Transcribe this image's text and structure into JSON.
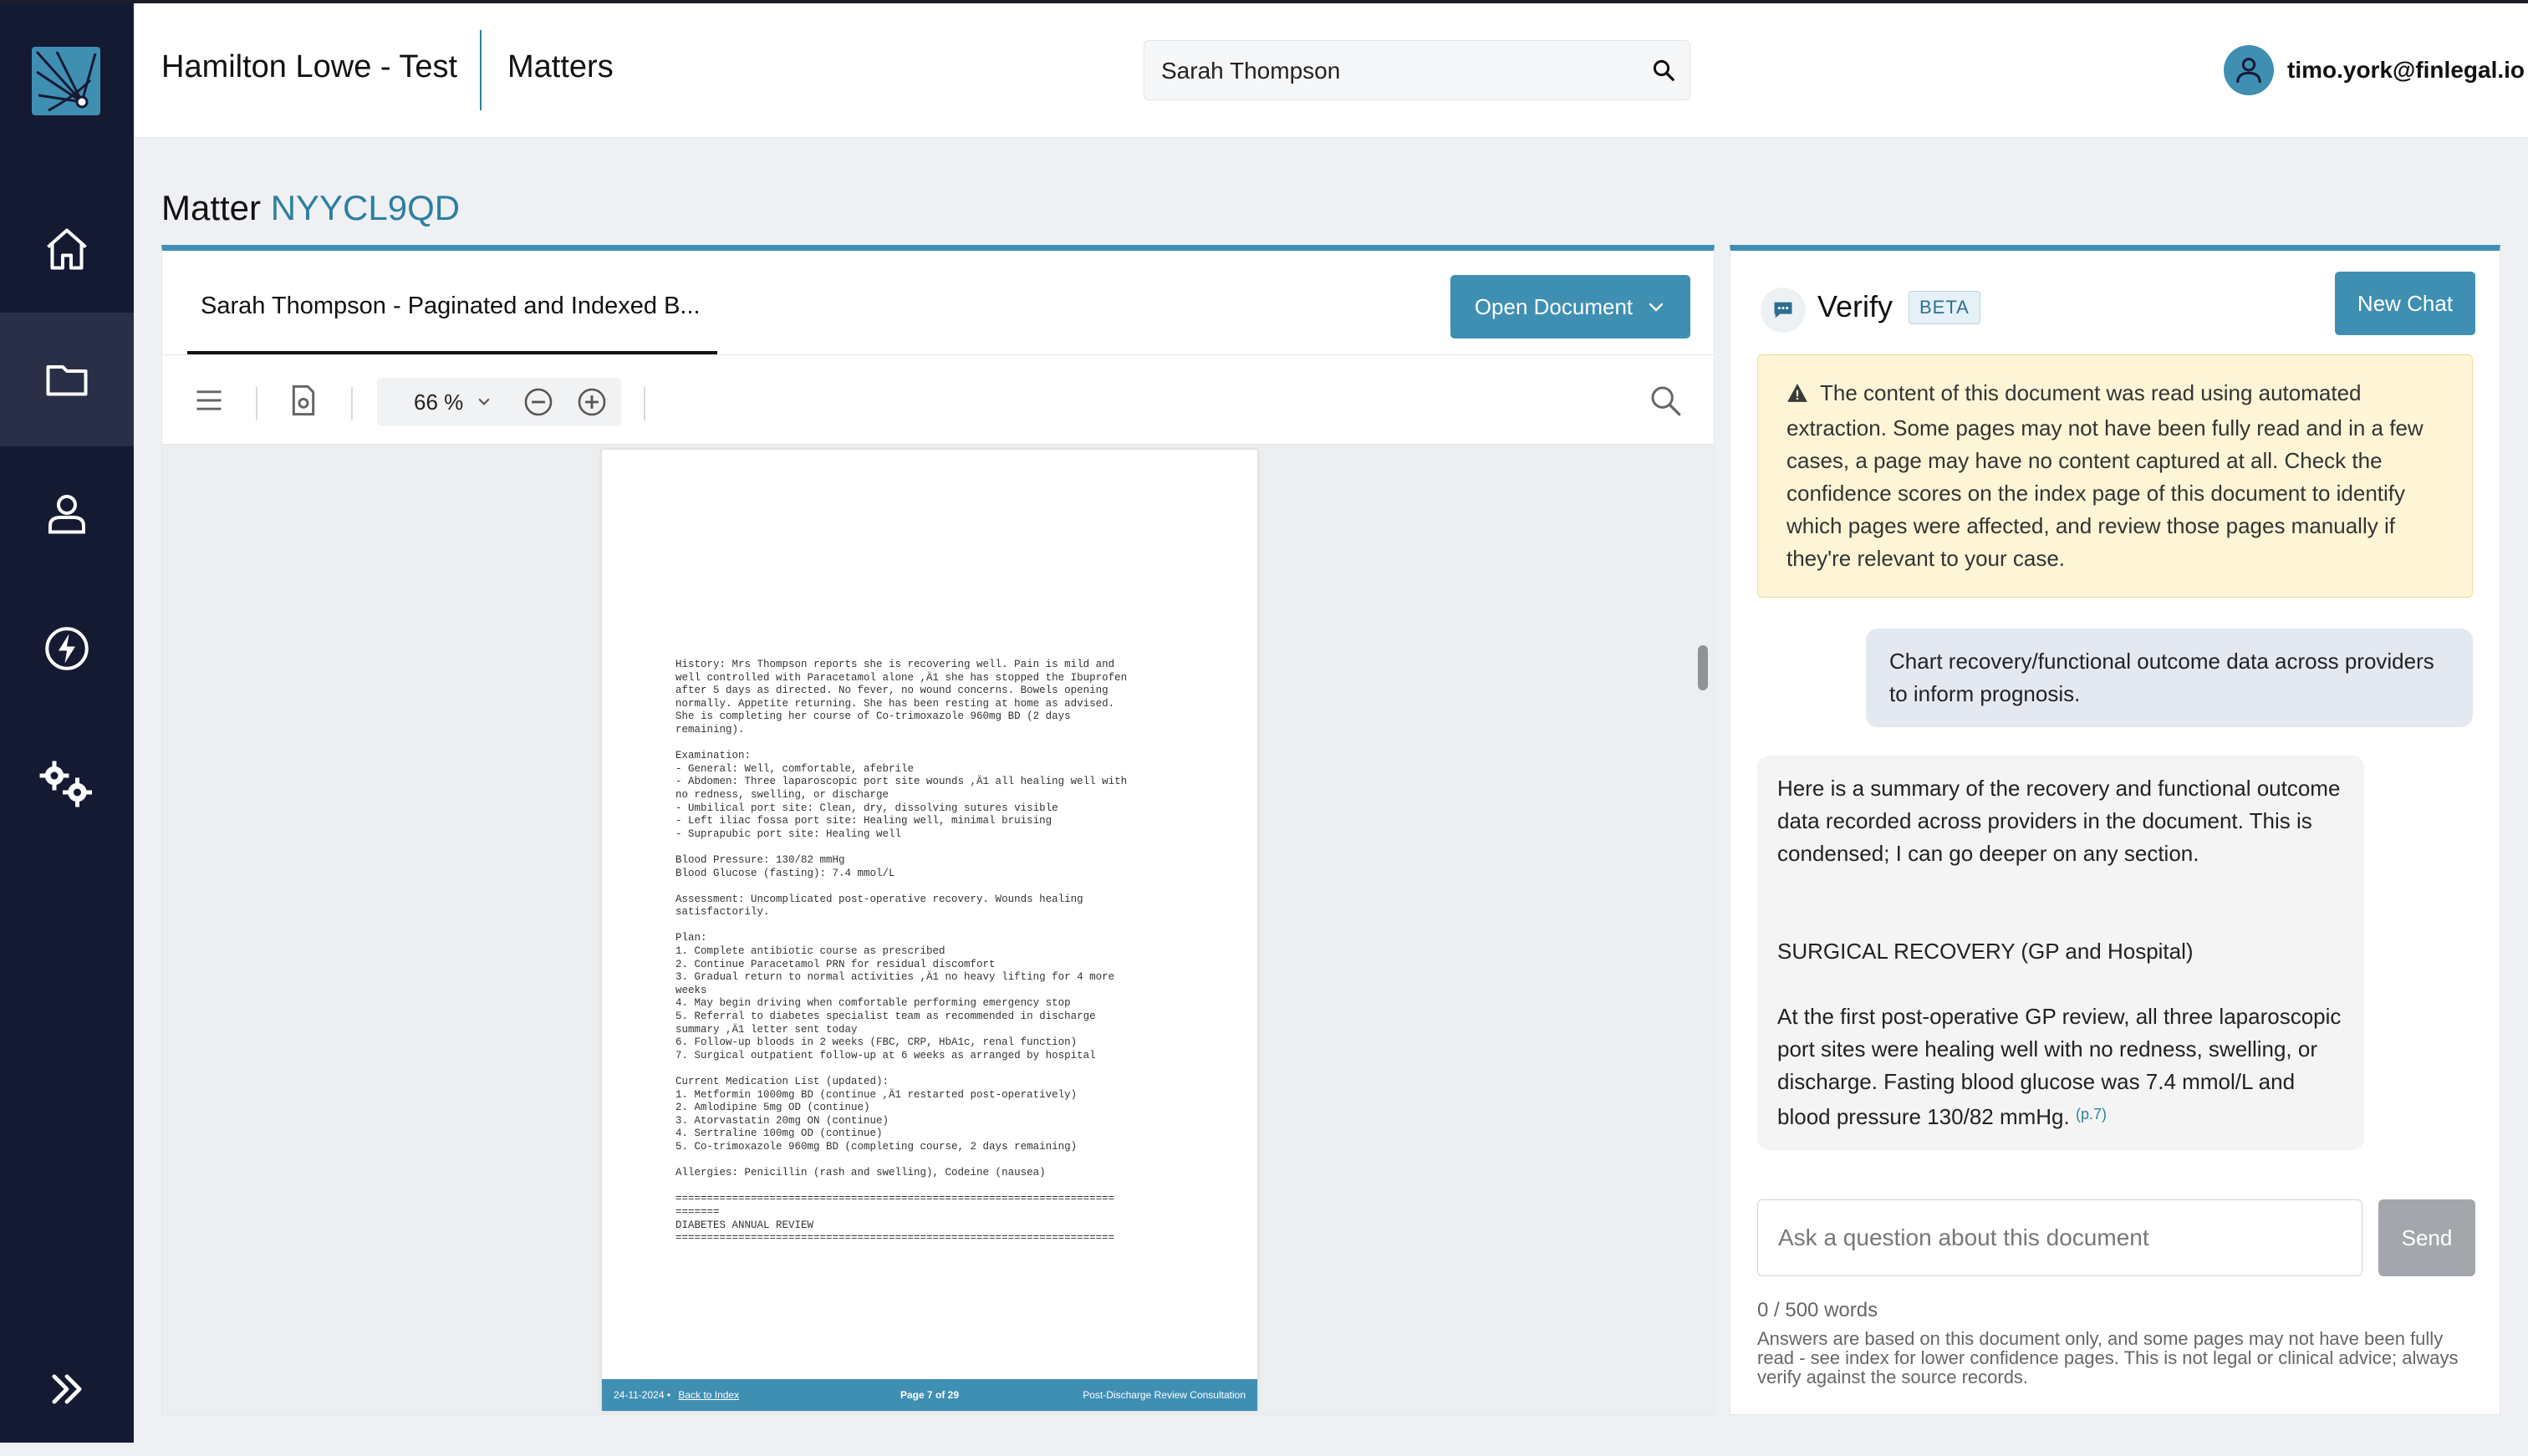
{
  "app": {
    "org_name": "Hamilton Lowe - Test",
    "section": "Matters",
    "user_email": "timo.york@finlegal.io"
  },
  "colors": {
    "sidebar": "#151a33",
    "accent": "#3f8fb3",
    "warning_bg": "#fdf5d6",
    "user_bubble": "#e3e8f1"
  },
  "search": {
    "value": "Sarah Thompson",
    "icon": "search-icon"
  },
  "sidebar": {
    "items": [
      {
        "name": "home",
        "icon": "home-icon",
        "active": false
      },
      {
        "name": "matters",
        "icon": "folder-icon",
        "active": true
      },
      {
        "name": "contacts",
        "icon": "user-icon",
        "active": false
      },
      {
        "name": "automations",
        "icon": "lightning-icon",
        "active": false
      },
      {
        "name": "settings",
        "icon": "gears-icon",
        "active": false
      }
    ],
    "expand_icon": "double-chevron-right-icon"
  },
  "matter": {
    "label": "Matter",
    "id": "NYYCL9QD"
  },
  "document": {
    "tab_title": "Sarah Thompson - Paginated and Indexed B...",
    "open_button": "Open Document",
    "zoom": "66 %",
    "page_text": "History: Mrs Thompson reports she is recovering well. Pain is mild and\nwell controlled with Paracetamol alone ,Ä1 she has stopped the Ibuprofen\nafter 5 days as directed. No fever, no wound concerns. Bowels opening\nnormally. Appetite returning. She has been resting at home as advised.\nShe is completing her course of Co-trimoxazole 960mg BD (2 days\nremaining).\n\nExamination:\n- General: Well, comfortable, afebrile\n- Abdomen: Three laparoscopic port site wounds ,Ä1 all healing well with\nno redness, swelling, or discharge\n- Umbilical port site: Clean, dry, dissolving sutures visible\n- Left iliac fossa port site: Healing well, minimal bruising\n- Suprapubic port site: Healing well\n\nBlood Pressure: 130/82 mmHg\nBlood Glucose (fasting): 7.4 mmol/L\n\nAssessment: Uncomplicated post-operative recovery. Wounds healing\nsatisfactorily.\n\nPlan:\n1. Complete antibiotic course as prescribed\n2. Continue Paracetamol PRN for residual discomfort\n3. Gradual return to normal activities ,Ä1 no heavy lifting for 4 more\nweeks\n4. May begin driving when comfortable performing emergency stop\n5. Referral to diabetes specialist team as recommended in discharge\nsummary ,Ä1 letter sent today\n6. Follow-up bloods in 2 weeks (FBC, CRP, HbA1c, renal function)\n7. Surgical outpatient follow-up at 6 weeks as arranged by hospital\n\nCurrent Medication List (updated):\n1. Metformin 1000mg BD (continue ,Ä1 restarted post-operatively)\n2. Amlodipine 5mg OD (continue)\n3. Atorvastatin 20mg ON (continue)\n4. Sertraline 100mg OD (continue)\n5. Co-trimoxazole 960mg BD (completing course, 2 days remaining)\n\nAllergies: Penicillin (rash and swelling), Codeine (nausea)\n\n======================================================================\n=======\nDIABETES ANNUAL REVIEW\n======================================================================",
    "footer": {
      "date": "24-11-2024 •",
      "back_link": "Back to Index",
      "page": "Page 7 of 29",
      "section": "Post-Discharge Review Consultation"
    }
  },
  "verify": {
    "title": "Verify",
    "badge": "BETA",
    "new_chat": "New Chat",
    "warning": "The content of this document was read using automated extraction. Some pages may not have been fully read and in a few cases, a page may have no content captured at all. Check the confidence scores on the index page of this document to identify which pages were affected, and review those pages manually if they're relevant to your case.",
    "user_message": "Chart recovery/functional outcome data across providers to inform prognosis.",
    "assistant": {
      "intro": "Here is a summary of the recovery and functional outcome data recorded across providers in the document. This is condensed; I can go deeper on any section.",
      "heading": "SURGICAL RECOVERY (GP and Hospital)",
      "paragraph": "At the first post-operative GP review, all three laparoscopic port sites were healing well with no redness, swelling, or discharge. Fasting blood glucose was 7.4 mmol/L and blood pressure 130/82 mmHg.",
      "citation": "(p.7)"
    },
    "input_placeholder": "Ask a question about this document",
    "send": "Send",
    "word_count": "0 / 500 words",
    "disclaimer": "Answers are based on this document only, and some pages may not have been fully read - see index for lower confidence pages. This is not legal or clinical advice; always verify against the source records."
  }
}
